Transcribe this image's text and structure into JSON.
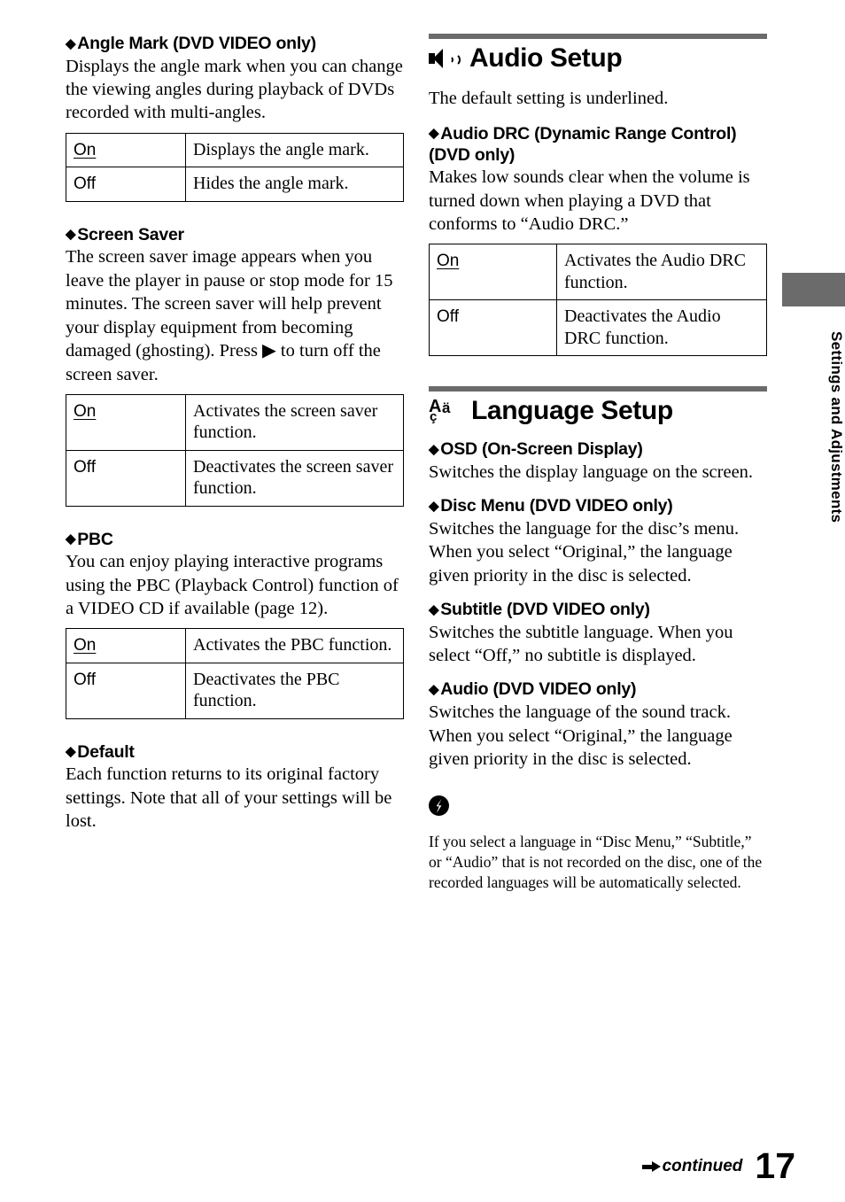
{
  "page": {
    "number": "17",
    "continued_label": "continued",
    "side_tab_label": "Settings and Adjustments"
  },
  "icons": {
    "speaker": "speaker-icon",
    "language": "language-characters-icon",
    "note": "note-bolt-icon",
    "play_arrow": "▶",
    "diamond": "◆"
  },
  "left_column": {
    "sections": [
      {
        "id": "angle-mark",
        "heading": "Angle Mark (DVD VIDEO only)",
        "paragraphs": [
          "Displays the angle mark when you can change the viewing angles during playback of DVDs recorded with multi-angles."
        ],
        "table": {
          "rows": [
            {
              "option": "On",
              "underlined": true,
              "description": "Displays the angle mark."
            },
            {
              "option": "Off",
              "underlined": false,
              "description": "Hides the angle mark."
            }
          ]
        }
      },
      {
        "id": "screen-saver",
        "heading": "Screen Saver",
        "paragraphs": [
          "The screen saver image appears when you leave the player in pause or stop mode for 15 minutes. The screen saver will help prevent your display equipment from becoming damaged (ghosting). Press ▶ to turn off the screen saver."
        ],
        "table": {
          "rows": [
            {
              "option": "On",
              "underlined": true,
              "description": "Activates the screen saver function."
            },
            {
              "option": "Off",
              "underlined": false,
              "description": "Deactivates the screen saver function."
            }
          ]
        }
      },
      {
        "id": "pbc",
        "heading": "PBC",
        "paragraphs": [
          "You can enjoy playing interactive programs using the PBC (Playback Control) function of a VIDEO CD if available (page 12)."
        ],
        "table": {
          "rows": [
            {
              "option": "On",
              "underlined": true,
              "description": "Activates the PBC function."
            },
            {
              "option": "Off",
              "underlined": false,
              "description": "Deactivates the PBC function."
            }
          ]
        }
      },
      {
        "id": "default",
        "heading": "Default",
        "paragraphs": [
          "Each function returns to its original factory settings. Note that all of your settings will be lost."
        ],
        "table": null
      }
    ]
  },
  "right_column": {
    "audio_setup": {
      "title": "Audio Setup",
      "intro": "The default setting is underlined.",
      "sections": [
        {
          "id": "audio-drc",
          "heading_line1": "Audio DRC (Dynamic Range Control)",
          "heading_line2": "(DVD only)",
          "paragraphs": [
            "Makes low sounds clear when the volume is turned down when playing a DVD that conforms to “Audio DRC.”"
          ],
          "table": {
            "rows": [
              {
                "option": "On",
                "underlined": true,
                "description": "Activates the Audio DRC function."
              },
              {
                "option": "Off",
                "underlined": false,
                "description": "Deactivates the Audio DRC function."
              }
            ]
          }
        }
      ]
    },
    "language_setup": {
      "title": "Language Setup",
      "sections": [
        {
          "id": "osd",
          "heading": "OSD (On-Screen Display)",
          "paragraphs": [
            "Switches the display language on the screen."
          ]
        },
        {
          "id": "disc-menu",
          "heading": "Disc Menu (DVD VIDEO only)",
          "paragraphs": [
            "Switches the language for the disc’s menu. When you select “Original,” the language given priority in the disc is selected."
          ]
        },
        {
          "id": "subtitle",
          "heading": "Subtitle (DVD VIDEO only)",
          "paragraphs": [
            "Switches the subtitle language. When you select “Off,” no subtitle is displayed."
          ]
        },
        {
          "id": "audio",
          "heading": "Audio (DVD VIDEO only)",
          "paragraphs": [
            "Switches the language of the sound track. When you select “Original,” the language given priority in the disc is selected."
          ]
        }
      ],
      "note": "If you select a language in “Disc Menu,” “Subtitle,” or “Audio” that is not recorded on the disc, one of the recorded languages will be automatically selected."
    }
  }
}
